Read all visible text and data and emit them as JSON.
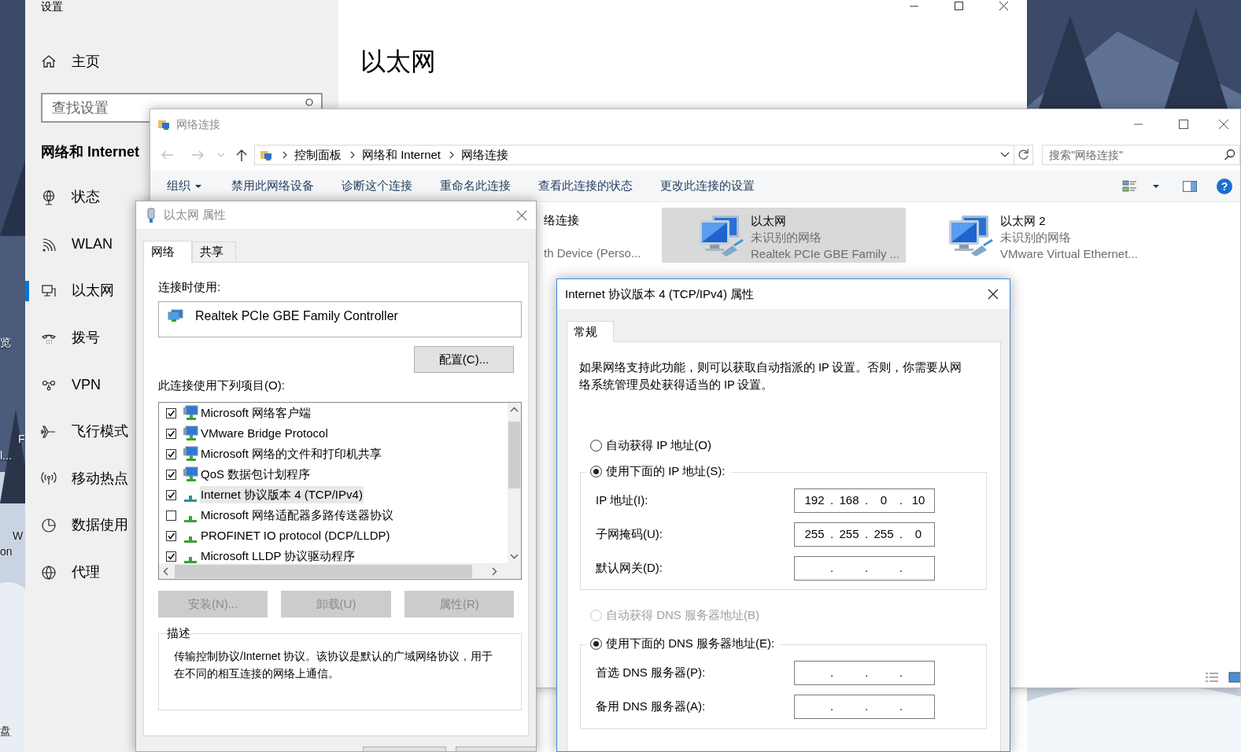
{
  "desktop": {
    "label_fragments": [
      "览",
      "F",
      "l...",
      "W",
      "on",
      "盘"
    ]
  },
  "settings_window": {
    "title": "设置",
    "home": "主页",
    "search": {
      "placeholder": "查找设置"
    },
    "section": "网络和 Internet",
    "nav": [
      {
        "label": "状态",
        "selected": false
      },
      {
        "label": "WLAN",
        "selected": false
      },
      {
        "label": "以太网",
        "selected": true
      },
      {
        "label": "拨号",
        "selected": false
      },
      {
        "label": "VPN",
        "selected": false
      },
      {
        "label": "飞行模式",
        "selected": false
      },
      {
        "label": "移动热点",
        "selected": false
      },
      {
        "label": "数据使用",
        "selected": false
      },
      {
        "label": "代理",
        "selected": false
      }
    ],
    "page_title": "以太网"
  },
  "network_connections": {
    "title": "网络连接",
    "breadcrumb": [
      "控制面板",
      "网络和 Internet",
      "网络连接"
    ],
    "search": {
      "placeholder": "搜索\"网络连接\""
    },
    "toolbar": [
      {
        "label": "组织",
        "kind": "menu"
      },
      {
        "label": "禁用此网络设备",
        "kind": "command"
      },
      {
        "label": "诊断这个连接",
        "kind": "command"
      },
      {
        "label": "重命名此连接",
        "kind": "command"
      },
      {
        "label": "查看此连接的状态",
        "kind": "command"
      },
      {
        "label": "更改此连接的设置",
        "kind": "command"
      }
    ],
    "help_glyph": "?",
    "connections": [
      {
        "kind": "clipped",
        "name": "络连接",
        "device": "th Device (Perso...",
        "selected": false
      },
      {
        "kind": "adapter",
        "name": "以太网",
        "status": "未识别的网络",
        "device": "Realtek PCIe GBE Family ...",
        "selected": true
      },
      {
        "kind": "adapter",
        "name": "以太网 2",
        "status": "未识别的网络",
        "device": "VMware Virtual Ethernet...",
        "selected": false
      }
    ]
  },
  "ethernet_properties": {
    "title": "以太网 属性",
    "tabs": [
      {
        "label": "网络",
        "selected": true
      },
      {
        "label": "共享",
        "selected": false
      }
    ],
    "connect_using_label": "连接时使用:",
    "adapter": "Realtek PCIe GBE Family Controller",
    "configure_button": "配置(C)...",
    "items_label": "此连接使用下列项目(O):",
    "items": [
      {
        "kind": "service",
        "label": "Microsoft 网络客户端",
        "checked": true,
        "selected": false
      },
      {
        "kind": "service",
        "label": "VMware Bridge Protocol",
        "checked": true,
        "selected": false
      },
      {
        "kind": "service",
        "label": "Microsoft 网络的文件和打印机共享",
        "checked": true,
        "selected": false
      },
      {
        "kind": "service",
        "label": "QoS 数据包计划程序",
        "checked": true,
        "selected": false
      },
      {
        "kind": "protocol",
        "label": "Internet 协议版本 4 (TCP/IPv4)",
        "checked": true,
        "selected": true
      },
      {
        "kind": "protocol",
        "label": "Microsoft 网络适配器多路传送器协议",
        "checked": false,
        "selected": false
      },
      {
        "kind": "protocol",
        "label": "PROFINET IO protocol (DCP/LLDP)",
        "checked": true,
        "selected": false
      },
      {
        "kind": "protocol",
        "label": "Microsoft LLDP 协议驱动程序",
        "checked": true,
        "selected": false
      }
    ],
    "buttons": [
      {
        "label": "安装(N)...",
        "disabled": true
      },
      {
        "label": "卸载(U)",
        "disabled": true
      },
      {
        "label": "属性(R)",
        "disabled": true
      }
    ],
    "description": {
      "legend": "描述",
      "text": "传输控制协议/Internet 协议。该协议是默认的广域网络协议，用于在不同的相互连接的网络上通信。"
    }
  },
  "ipv4_properties": {
    "title": "Internet 协议版本 4 (TCP/IPv4) 属性",
    "tabs": [
      {
        "label": "常规",
        "selected": true
      }
    ],
    "intro": "如果网络支持此功能，则可以获取自动指派的 IP 设置。否则，你需要从网络系统管理员处获得适当的 IP 设置。",
    "ip_options": [
      {
        "label": "自动获得 IP 地址(O)",
        "selected": false,
        "disabled": false
      },
      {
        "label": "使用下面的 IP 地址(S):",
        "selected": true,
        "disabled": false
      }
    ],
    "ip_fields": [
      {
        "label": "IP 地址(I):",
        "octets": [
          "192",
          "168",
          "0",
          "10"
        ],
        "separators": [
          ".",
          ".",
          "."
        ]
      },
      {
        "label": "子网掩码(U):",
        "octets": [
          "255",
          "255",
          "255",
          "0"
        ],
        "separators": [
          ".",
          ".",
          "."
        ]
      },
      {
        "label": "默认网关(D):",
        "separators": [
          ".",
          ".",
          "."
        ]
      }
    ],
    "dns_options": [
      {
        "label": "自动获得 DNS 服务器地址(B)",
        "selected": false,
        "disabled": true
      },
      {
        "label": "使用下面的 DNS 服务器地址(E):",
        "selected": true,
        "disabled": false
      }
    ],
    "dns_fields": [
      {
        "label": "首选 DNS 服务器(P):",
        "separators": [
          ".",
          ".",
          "."
        ]
      },
      {
        "label": "备用 DNS 服务器(A):",
        "separators": [
          ".",
          ".",
          "."
        ]
      }
    ]
  }
}
